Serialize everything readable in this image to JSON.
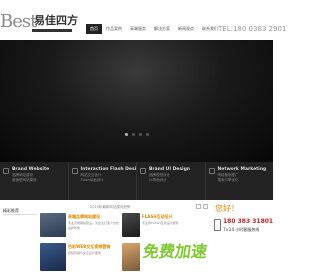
{
  "brand": {
    "logo_en": "Best",
    "logo_cn": "易佳四方"
  },
  "nav": {
    "items": [
      "首页",
      "作品案例",
      "高端服务",
      "解决方案",
      "新闻观点",
      "联系我们"
    ],
    "active_index": 0
  },
  "header": {
    "phone": "TEL:180 0383 2901"
  },
  "banner": {
    "slide_count": 4,
    "active_slide": 1
  },
  "services": [
    {
      "title": "Brand Website",
      "lines": [
        "品牌网站建设",
        "营销型网站建设"
      ]
    },
    {
      "title": "Interaction Flash Design",
      "lines": [
        "网站交互设计",
        "Flash动画设计"
      ]
    },
    {
      "title": "Brand UI Design",
      "lines": [
        "品牌视觉设计",
        "UI界面设计"
      ]
    },
    {
      "title": "Network Marketing",
      "lines": [
        "网络营销推广",
        "搜索引擎优化"
      ]
    }
  ],
  "sidebar": {
    "label": "精彩推荐"
  },
  "news": {
    "text": "2019年最新网站建设趋势"
  },
  "cards": [
    {
      "title": "高端品牌网站建设",
      "desc": "专业高端网站建设，为企业打造个性化品牌形象"
    },
    {
      "title": "FLASH互动设计",
      "desc": "专业的FLASH互动设计服务"
    },
    {
      "title": "色彩WEB交互视频营销",
      "desc": "视频营销与交互设计服务"
    },
    {
      "title": "",
      "desc": ""
    }
  ],
  "contact": {
    "hello": "您好！",
    "phone": "180 383 31801",
    "hours": "7×24 小时客服热线"
  },
  "watermark": "免费加速"
}
